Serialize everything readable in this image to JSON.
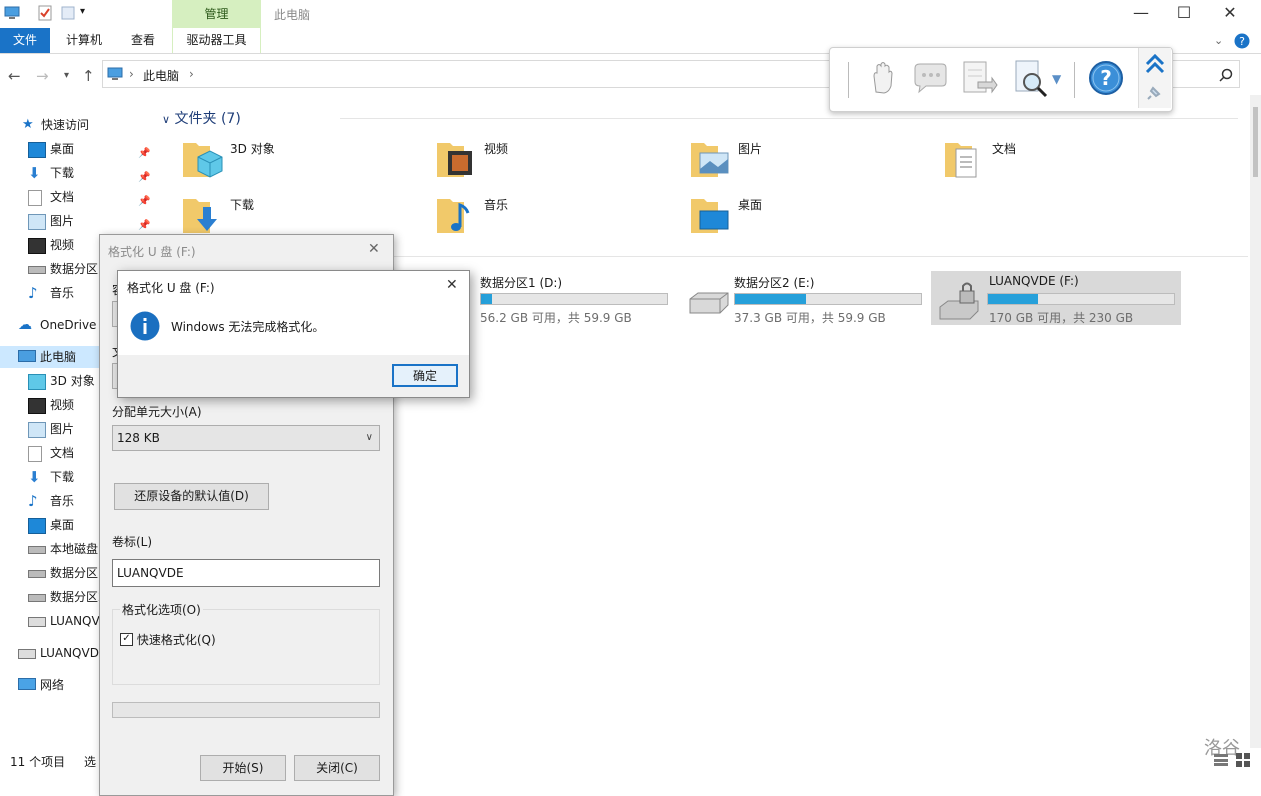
{
  "window": {
    "title": "此电脑",
    "context_tab": "管理",
    "minimize": "—",
    "maximize": "☐",
    "close": "✕"
  },
  "ribbon": {
    "tabs": [
      "文件",
      "计算机",
      "查看",
      "驱动器工具"
    ]
  },
  "address": {
    "path": "此电脑",
    "separator": "›"
  },
  "sidebar": {
    "quick_access": "快速访问",
    "quick_items": [
      "桌面",
      "下载",
      "文档",
      "图片",
      "视频",
      "数据分区",
      "音乐"
    ],
    "onedrive": "OneDrive",
    "this_pc": "此电脑",
    "pc_items": [
      "3D 对象",
      "视频",
      "图片",
      "文档",
      "下载",
      "音乐",
      "桌面",
      "本地磁盘",
      "数据分区",
      "数据分区2",
      "LUANQV"
    ],
    "usb": "LUANQVD",
    "network": "网络"
  },
  "main": {
    "folders_header": "文件夹 (7)",
    "folders": [
      "3D 对象",
      "视频",
      "图片",
      "文档",
      "下载",
      "音乐",
      "桌面"
    ],
    "drives": [
      {
        "name": "数据分区1 (D:)",
        "size": "56.2 GB 可用，共 59.9 GB",
        "used": 0.06
      },
      {
        "name": "数据分区2 (E:)",
        "size": "37.3 GB 可用，共 59.9 GB",
        "used": 0.38
      },
      {
        "name": "LUANQVDE (F:)",
        "size": "170 GB 可用，共 230 GB",
        "used": 0.27
      }
    ]
  },
  "format_dialog": {
    "title": "格式化 U 盘 (F:)",
    "close": "✕",
    "capacity_initial": "容",
    "fs_initial": "文",
    "alloc_label": "分配单元大小(A)",
    "alloc_value": "128 KB",
    "restore_defaults": "还原设备的默认值(D)",
    "volume_label": "卷标(L)",
    "volume_value": "LUANQVDE",
    "options_label": "格式化选项(O)",
    "quick_format": "快速格式化(Q)",
    "start": "开始(S)",
    "close_btn": "关闭(C)"
  },
  "message_box": {
    "title": "格式化 U 盘 (F:)",
    "close": "✕",
    "message": "Windows 无法完成格式化。",
    "ok": "确定"
  },
  "status": {
    "items": "11 个项目",
    "selected": "选"
  },
  "watermark": "洛谷",
  "colors": {
    "accent": "#1a73c7",
    "context_tab": "#d6efc0",
    "drive_fill": "#26a0da",
    "info_icon": "#1a6fc0"
  }
}
